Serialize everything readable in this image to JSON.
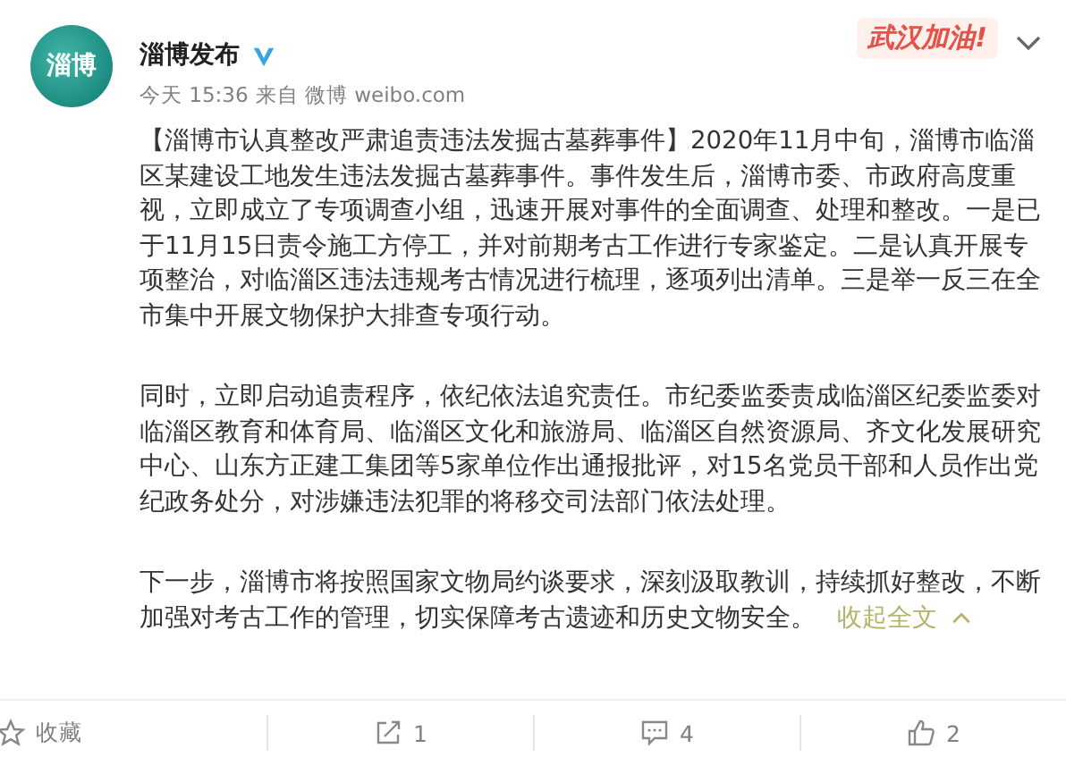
{
  "post": {
    "author": "淄博发布",
    "avatar_text": "淄博",
    "verified": true,
    "time": "今天 15:36",
    "source": "来自 微博 weibo.com",
    "badge": "武汉加油!",
    "paragraphs": [
      "【淄博市认真整改严肃追责违法发掘古墓葬事件】2020年11月中旬，淄博市临淄区某建设工地发生违法发掘古墓葬事件。事件发生后，淄博市委、市政府高度重视，立即成立了专项调查小组，迅速开展对事件的全面调查、处理和整改。一是已于11月15日责令施工方停工，并对前期考古工作进行专家鉴定。二是认真开展专项整治，对临淄区违法违规考古情况进行梳理，逐项列出清单。三是举一反三在全市集中开展文物保护大排查专项行动。",
      "同时，立即启动追责程序，依纪依法追究责任。市纪委监委责成临淄区纪委监委对临淄区教育和体育局、临淄区文化和旅游局、临淄区自然资源局、齐文化发展研究中心、山东方正建工集团等5家单位作出通报批评，对15名党员干部和人员作出党纪政务处分，对涉嫌违法犯罪的将移交司法部门依法处理。",
      "下一步，淄博市将按照国家文物局约谈要求，深刻汲取教训，持续抓好整改，不断加强对考古工作的管理，切实保障考古遗迹和历史文物安全。"
    ],
    "collapse_link": "收起全文"
  },
  "actions": [
    {
      "kind": "favorite",
      "label": "收藏"
    },
    {
      "kind": "repost",
      "label": "1"
    },
    {
      "kind": "comment",
      "label": "4"
    },
    {
      "kind": "like",
      "label": "2"
    }
  ]
}
